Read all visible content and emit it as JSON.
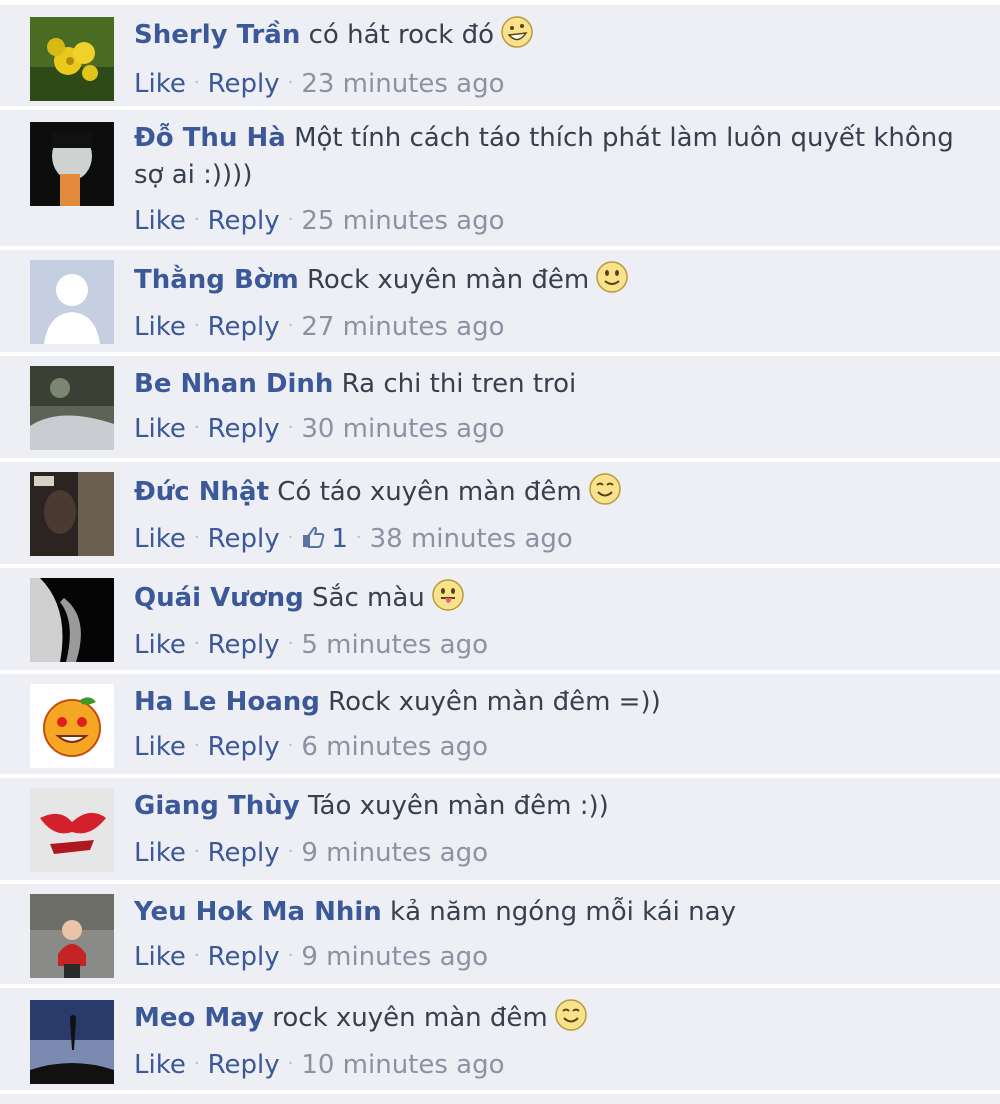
{
  "comments": [
    {
      "author": "Sherly Trần",
      "text": "có hát rock đó",
      "emoticon": "grin-icon",
      "like_label": "Like",
      "reply_label": "Reply",
      "likes": "",
      "time": "23 minutes ago"
    },
    {
      "author": "Đỗ Thu Hà",
      "text": "Một tính cách táo thích phát làm luôn quyết không sợ ai :))))",
      "emoticon": "",
      "like_label": "Like",
      "reply_label": "Reply",
      "likes": "",
      "time": "25 minutes ago"
    },
    {
      "author": "Thằng Bờm",
      "text": "Rock xuyên màn đêm",
      "emoticon": "smile-icon",
      "like_label": "Like",
      "reply_label": "Reply",
      "likes": "",
      "time": "27 minutes ago"
    },
    {
      "author": "Be Nhan Dinh",
      "text": "Ra chi thi tren troi",
      "emoticon": "",
      "like_label": "Like",
      "reply_label": "Reply",
      "likes": "",
      "time": "30 minutes ago"
    },
    {
      "author": "Đức Nhật",
      "text": "Có táo xuyên màn đêm",
      "emoticon": "content-smile-icon",
      "like_label": "Like",
      "reply_label": "Reply",
      "likes": "1",
      "time": "38 minutes ago"
    },
    {
      "author": "Quái Vương",
      "text": "Sắc màu",
      "emoticon": "tongue-icon",
      "like_label": "Like",
      "reply_label": "Reply",
      "likes": "",
      "time": "5 minutes ago"
    },
    {
      "author": "Ha Le Hoang",
      "text": "Rock xuyên màn đêm =))",
      "emoticon": "",
      "like_label": "Like",
      "reply_label": "Reply",
      "likes": "",
      "time": "6 minutes ago"
    },
    {
      "author": "Giang Thùy",
      "text": "Táo xuyên màn đêm :))",
      "emoticon": "",
      "like_label": "Like",
      "reply_label": "Reply",
      "likes": "",
      "time": "9 minutes ago"
    },
    {
      "author": "Yeu Hok Ma Nhin",
      "text": "kả năm ngóng mỗi kái nay",
      "emoticon": "",
      "like_label": "Like",
      "reply_label": "Reply",
      "likes": "",
      "time": "9 minutes ago"
    },
    {
      "author": "Meo May",
      "text": "rock xuyên màn đêm",
      "emoticon": "content-smile-icon",
      "like_label": "Like",
      "reply_label": "Reply",
      "likes": "",
      "time": "10 minutes ago"
    }
  ],
  "colors": {
    "author": "#3b5998",
    "background": "#edeff4",
    "meta": "#8b93a3"
  }
}
